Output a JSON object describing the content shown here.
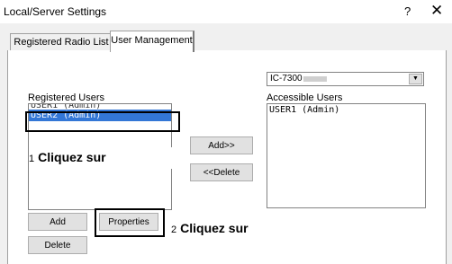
{
  "window": {
    "title": "Local/Server Settings",
    "help": "?",
    "close": "✕"
  },
  "tabs": [
    {
      "label": "Registered Radio List"
    },
    {
      "label": "User Management"
    }
  ],
  "registered_users": {
    "label": "Registered Users",
    "items": [
      "USER1 (Admin)",
      "USER2 (Admin)"
    ],
    "selected": "USER2 (Admin)"
  },
  "accessible_users": {
    "label": "Accessible Users",
    "items": [
      "USER1 (Admin)"
    ]
  },
  "radio_select": {
    "value": "IC-7300"
  },
  "buttons": {
    "add_to": "Add>>",
    "delete_from": "<<Delete",
    "add": "Add",
    "properties": "Properties",
    "delete": "Delete"
  },
  "callouts": {
    "step1": {
      "num": "1",
      "text": "Cliquez sur"
    },
    "step2": {
      "num": "2",
      "text": "Cliquez sur"
    }
  }
}
